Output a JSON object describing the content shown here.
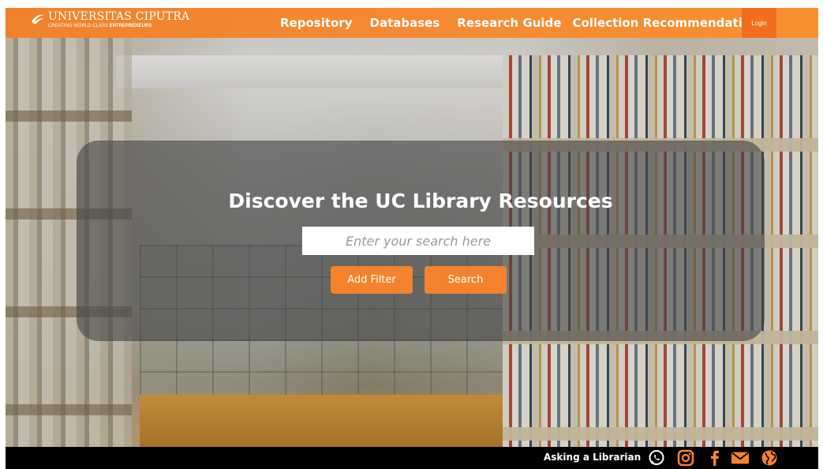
{
  "brand": {
    "name": "UNIVERSITAS CIPUTRA",
    "tagline_prefix": "CREATING WORLD CLASS",
    "tagline_bold": "ENTREPRENEURS"
  },
  "nav": {
    "items": [
      {
        "label": "Repository"
      },
      {
        "label": "Databases"
      },
      {
        "label": "Research Guide"
      },
      {
        "label": "Collection Recommendation"
      }
    ],
    "login_label": "Login"
  },
  "hero": {
    "title": "Discover the UC Library Resources",
    "search_placeholder": "Enter your search here",
    "filter_label": "Add Filter",
    "search_label": "Search"
  },
  "footer": {
    "label": "Asking a Librarian",
    "icons": [
      "whatsapp-icon",
      "instagram-icon",
      "facebook-icon",
      "mail-icon",
      "globe-icon"
    ]
  },
  "colors": {
    "accent": "#f5822c",
    "login_bg": "#f26d1e",
    "footer_bg": "#000000"
  }
}
